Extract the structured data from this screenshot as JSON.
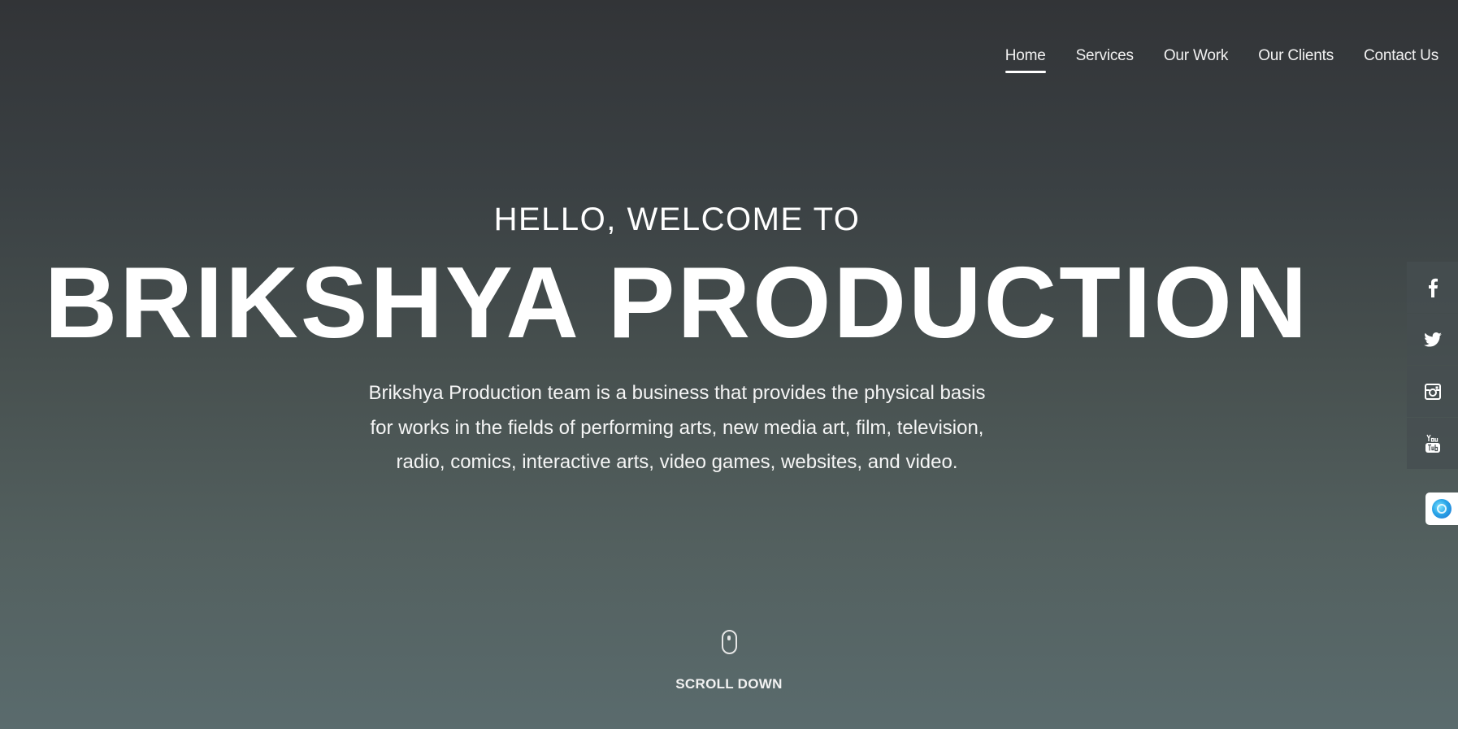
{
  "nav": {
    "items": [
      {
        "label": "Home",
        "active": true
      },
      {
        "label": "Services",
        "active": false
      },
      {
        "label": "Our Work",
        "active": false
      },
      {
        "label": "Our Clients",
        "active": false
      },
      {
        "label": "Contact Us",
        "active": false
      }
    ]
  },
  "hero": {
    "subtitle": "HELLO, WELCOME TO",
    "title": "BRIKSHYA PRODUCTION",
    "description": "Brikshya Production team is a business that provides the physical basis for works in the fields of performing arts, new media art, film, television, radio, comics, interactive arts, video games, websites, and video."
  },
  "scroll": {
    "label": "SCROLL DOWN",
    "icon": "mouse-icon"
  },
  "social": [
    {
      "icon": "facebook-icon"
    },
    {
      "icon": "twitter-icon"
    },
    {
      "icon": "instagram-icon"
    },
    {
      "icon": "youtube-icon"
    }
  ],
  "chat_widget": {
    "icon": "chat-orb-icon"
  },
  "colors": {
    "background_top": "#323437",
    "background_bottom": "#5a6b6d",
    "text": "#ffffff",
    "social_bg": "#464e50"
  }
}
